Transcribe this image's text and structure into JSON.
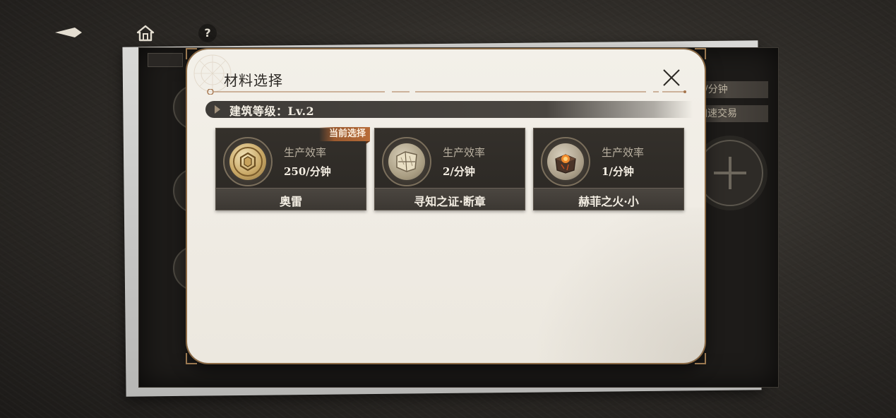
{
  "nav": {
    "back_icon": "back-arrow-icon",
    "home_icon": "home-icon",
    "help_label": "?"
  },
  "background_panel": {
    "pill_1": "/分钟",
    "pill_2": "加速交易"
  },
  "dialog": {
    "title": "材料选择",
    "close_icon": "close-icon",
    "level_label": "建筑等级：Lv.2",
    "accent_color": "#b86c38",
    "cards": [
      {
        "name": "奥雷",
        "rate_label": "生产效率",
        "rate_value": "250/分钟",
        "icon": "gold-coin-icon",
        "selected": true,
        "selected_label": "当前选择"
      },
      {
        "name": "寻知之证·断章",
        "rate_label": "生产效率",
        "rate_value": "2/分钟",
        "icon": "scroll-fragment-icon",
        "selected": false
      },
      {
        "name": "赫菲之火·小",
        "rate_label": "生产效率",
        "rate_value": "1/分钟",
        "icon": "fire-crystal-icon",
        "selected": false
      }
    ]
  }
}
